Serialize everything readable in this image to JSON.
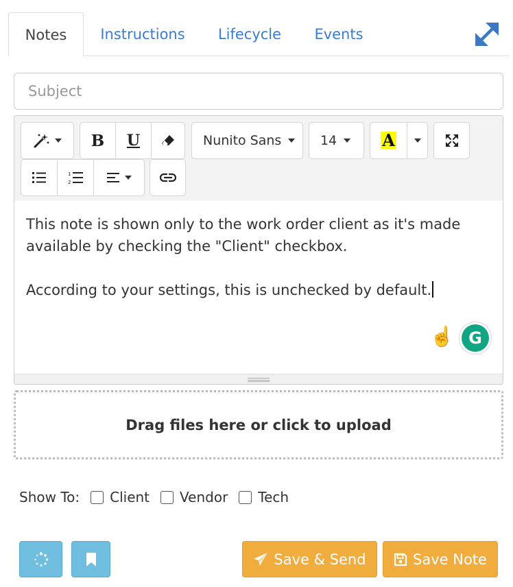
{
  "tabs": [
    {
      "label": "Notes",
      "active": true
    },
    {
      "label": "Instructions",
      "active": false
    },
    {
      "label": "Lifecycle",
      "active": false
    },
    {
      "label": "Events",
      "active": false
    }
  ],
  "subject": {
    "placeholder": "Subject",
    "value": ""
  },
  "toolbar": {
    "font_family": "Nunito Sans",
    "font_size": "14",
    "color_letter": "A",
    "bold_letter": "B",
    "underline_letter": "U"
  },
  "content": {
    "paragraph_1": "This note is shown only to the work order client as it's made available by checking the \"Client\" checkbox.",
    "paragraph_2": "According to your settings, this is unchecked by default.",
    "emoji": "☝️",
    "grammarly_letter": "G"
  },
  "dropzone": {
    "label": "Drag files here or click to upload"
  },
  "show_to": {
    "label": "Show To:",
    "options": [
      {
        "label": "Client",
        "checked": false
      },
      {
        "label": "Vendor",
        "checked": false
      },
      {
        "label": "Tech",
        "checked": false
      }
    ]
  },
  "buttons": {
    "save_send": "Save & Send",
    "save_note": "Save Note"
  },
  "colors": {
    "link": "#3a7bd5",
    "info": "#6fbee0",
    "warning": "#f0ad3e",
    "highlight": "#ffff00",
    "grammarly": "#11a683"
  }
}
